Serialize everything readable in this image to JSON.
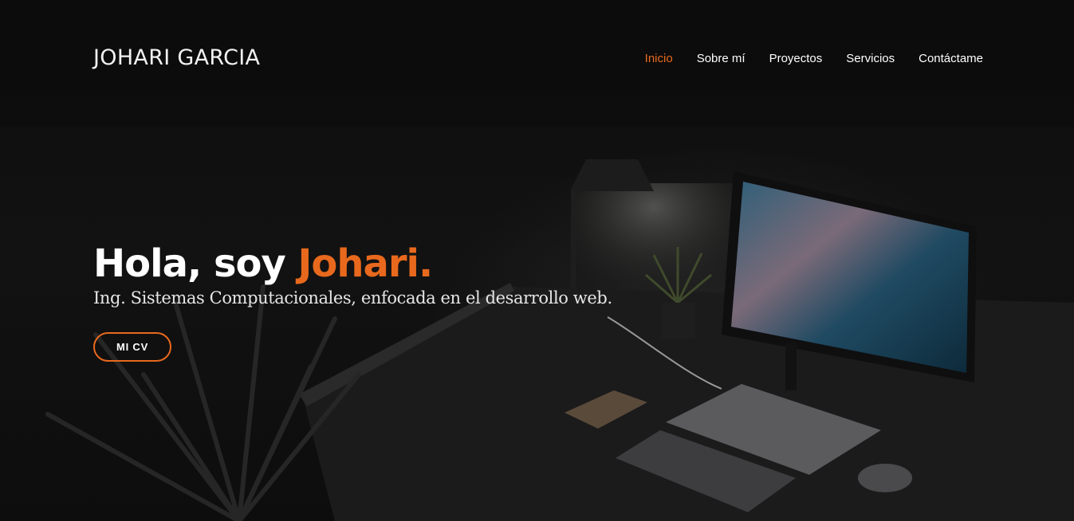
{
  "header": {
    "brand": "JOHARI GARCIA",
    "nav": [
      {
        "label": "Inicio",
        "active": true
      },
      {
        "label": "Sobre mí",
        "active": false
      },
      {
        "label": "Proyectos",
        "active": false
      },
      {
        "label": "Servicios",
        "active": false
      },
      {
        "label": "Contáctame",
        "active": false
      }
    ]
  },
  "hero": {
    "greeting": "Hola, soy ",
    "name": "Johari.",
    "subtitle": "Ing. Sistemas Computacionales, enfocada en el desarrollo web.",
    "cta_label": "MI CV"
  },
  "colors": {
    "accent": "#e8691d",
    "background": "#0c0c0c",
    "text": "#ffffff"
  }
}
